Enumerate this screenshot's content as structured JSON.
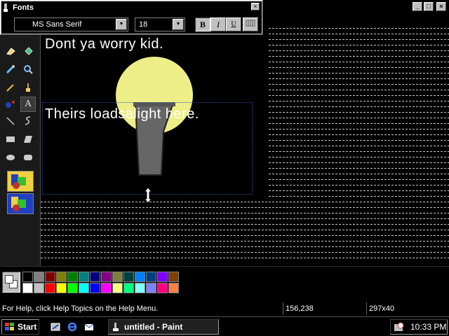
{
  "fonts_toolbar": {
    "title": "Fonts",
    "close_glyph": "×",
    "font_name": "MS Sans Serif",
    "font_size": "18",
    "dropdown_glyph": "▼",
    "bold_label": "B",
    "italic_label": "I",
    "underline_label": "U"
  },
  "window_controls": {
    "minimize": "_",
    "maximize": "□",
    "close": "×"
  },
  "canvas": {
    "text_line1": "Dont ya worry kid.",
    "text_line2": "Theirs loadsalight here."
  },
  "statusbar": {
    "help_text": "For Help, click Help Topics on the Help Menu.",
    "coords": "156,238",
    "selection_size": "297x40"
  },
  "taskbar": {
    "start_label": "Start",
    "task_label": "untitled - Paint",
    "clock": "10:33 PM"
  },
  "palette": {
    "row1": [
      "#000000",
      "#808080",
      "#800000",
      "#808000",
      "#008000",
      "#008080",
      "#000080",
      "#800080",
      "#808040",
      "#004040",
      "#0080ff",
      "#004080",
      "#8000ff",
      "#804000"
    ],
    "row2": [
      "#ffffff",
      "#c0c0c0",
      "#ff0000",
      "#ffff00",
      "#00ff00",
      "#00ffff",
      "#0000ff",
      "#ff00ff",
      "#ffff80",
      "#00ff80",
      "#80ffff",
      "#8080ff",
      "#ff0080",
      "#ff8040"
    ]
  },
  "colors": {
    "lamp_glow": "#eeee88",
    "lamp_body": "#666666",
    "canvas_bg": "#000000"
  },
  "icons": [
    "paint-app-icon",
    "free-select-icon",
    "select-icon",
    "eraser-icon",
    "fill-icon",
    "pick-color-icon",
    "magnifier-icon",
    "pencil-icon",
    "brush-icon",
    "airbrush-icon",
    "text-icon",
    "line-icon",
    "curve-icon",
    "rectangle-icon",
    "polygon-icon",
    "ellipse-icon",
    "rounded-rect-icon",
    "opaque-option-icon",
    "transparent-option-icon",
    "resize-cursor-icon"
  ]
}
